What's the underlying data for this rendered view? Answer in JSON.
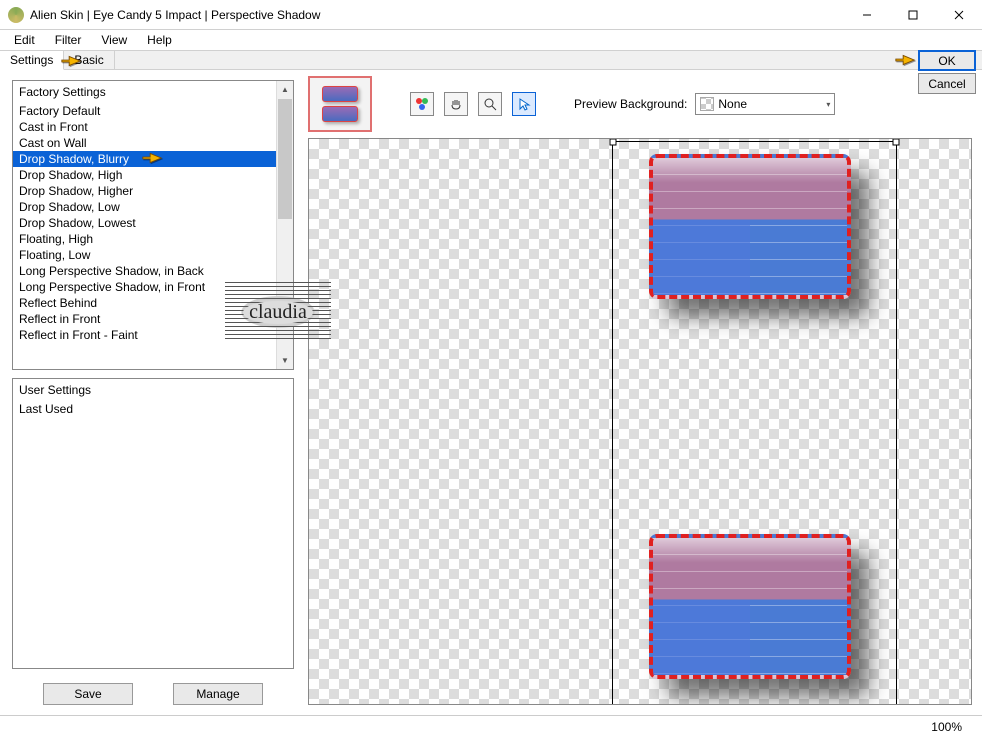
{
  "title": "Alien Skin | Eye Candy 5 Impact | Perspective Shadow",
  "menu": {
    "edit": "Edit",
    "filter": "Filter",
    "view": "View",
    "help": "Help"
  },
  "tabs": {
    "settings": "Settings",
    "basic": "Basic"
  },
  "buttons": {
    "ok": "OK",
    "cancel": "Cancel",
    "save": "Save",
    "manage": "Manage"
  },
  "factory": {
    "header": "Factory Settings",
    "items": [
      "Factory Default",
      "Cast in Front",
      "Cast on Wall",
      "Drop Shadow, Blurry",
      "Drop Shadow, High",
      "Drop Shadow, Higher",
      "Drop Shadow, Low",
      "Drop Shadow, Lowest",
      "Floating, High",
      "Floating, Low",
      "Long Perspective Shadow, in Back",
      "Long Perspective Shadow, in Front",
      "Reflect Behind",
      "Reflect in Front",
      "Reflect in Front - Faint"
    ],
    "selected_index": 3
  },
  "user_settings": {
    "header": "User Settings",
    "items": [
      "Last Used"
    ]
  },
  "preview_bg": {
    "label": "Preview Background:",
    "value": "None"
  },
  "watermark": "claudia",
  "zoom": "100%"
}
